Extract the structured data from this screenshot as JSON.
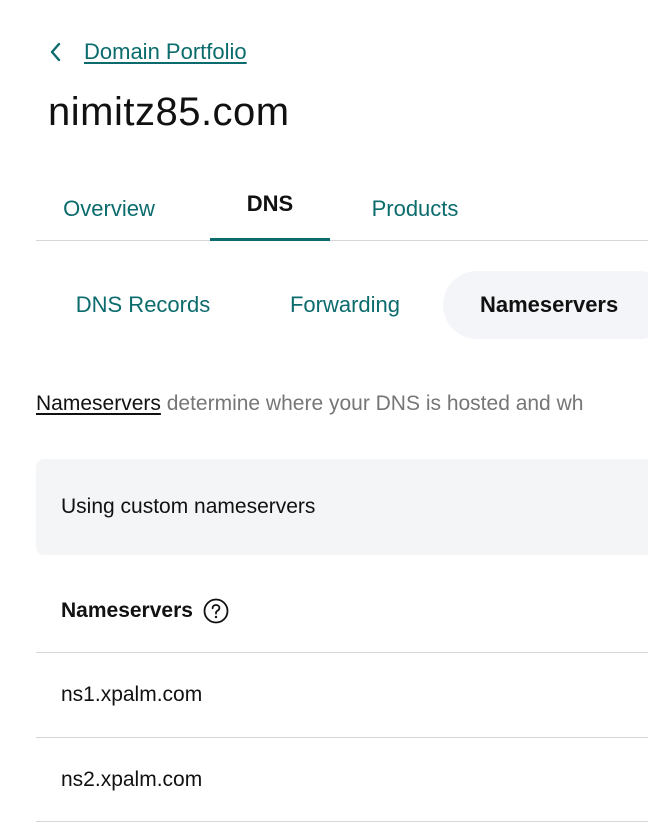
{
  "breadcrumb": {
    "back_icon": "chevron-left-icon",
    "link_label": "Domain Portfolio"
  },
  "page": {
    "title": "nimitz85.com"
  },
  "tabs": [
    {
      "label": "Overview",
      "active": false
    },
    {
      "label": "DNS",
      "active": true
    },
    {
      "label": "Products",
      "active": false
    }
  ],
  "subtabs": [
    {
      "label": "DNS Records",
      "active": false
    },
    {
      "label": "Forwarding",
      "active": false
    },
    {
      "label": "Nameservers",
      "active": true
    }
  ],
  "description": {
    "link_text": "Nameservers",
    "text": " determine where your DNS is hosted and wh"
  },
  "banner": {
    "text": "Using custom nameservers"
  },
  "nameservers": {
    "header": "Nameservers",
    "help_icon": "question-circle-icon",
    "items": [
      "ns1.xpalm.com",
      "ns2.xpalm.com"
    ]
  },
  "colors": {
    "accent": "#0b6b6d",
    "text": "#111111",
    "muted": "#767676",
    "pill_background": "#f3f5f8",
    "banner_background": "#f4f5f7",
    "divider": "#d6d6d6"
  }
}
